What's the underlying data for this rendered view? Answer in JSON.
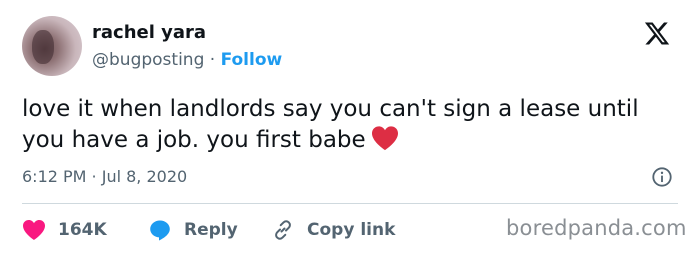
{
  "tweet": {
    "author_name": "rachel yara",
    "handle": "@bugposting",
    "separator": "·",
    "follow_label": "Follow",
    "text": "love it when landlords say you can't sign a lease until you have a job. you first babe",
    "emoji": "red-heart-emoji",
    "timestamp": "6:12 PM · Jul 8, 2020"
  },
  "actions": {
    "like_count": "164K",
    "reply_label": "Reply",
    "copy_label": "Copy link"
  },
  "icons": [
    "x-logo-icon",
    "info-icon",
    "heart-icon",
    "reply-bubble-icon",
    "link-icon"
  ],
  "watermark": "boredpanda.com",
  "colors": {
    "follow": "#1d9bf0",
    "like": "#f91880",
    "reply": "#1d9bf0",
    "muted": "#536471",
    "divider": "#cfd9de"
  }
}
